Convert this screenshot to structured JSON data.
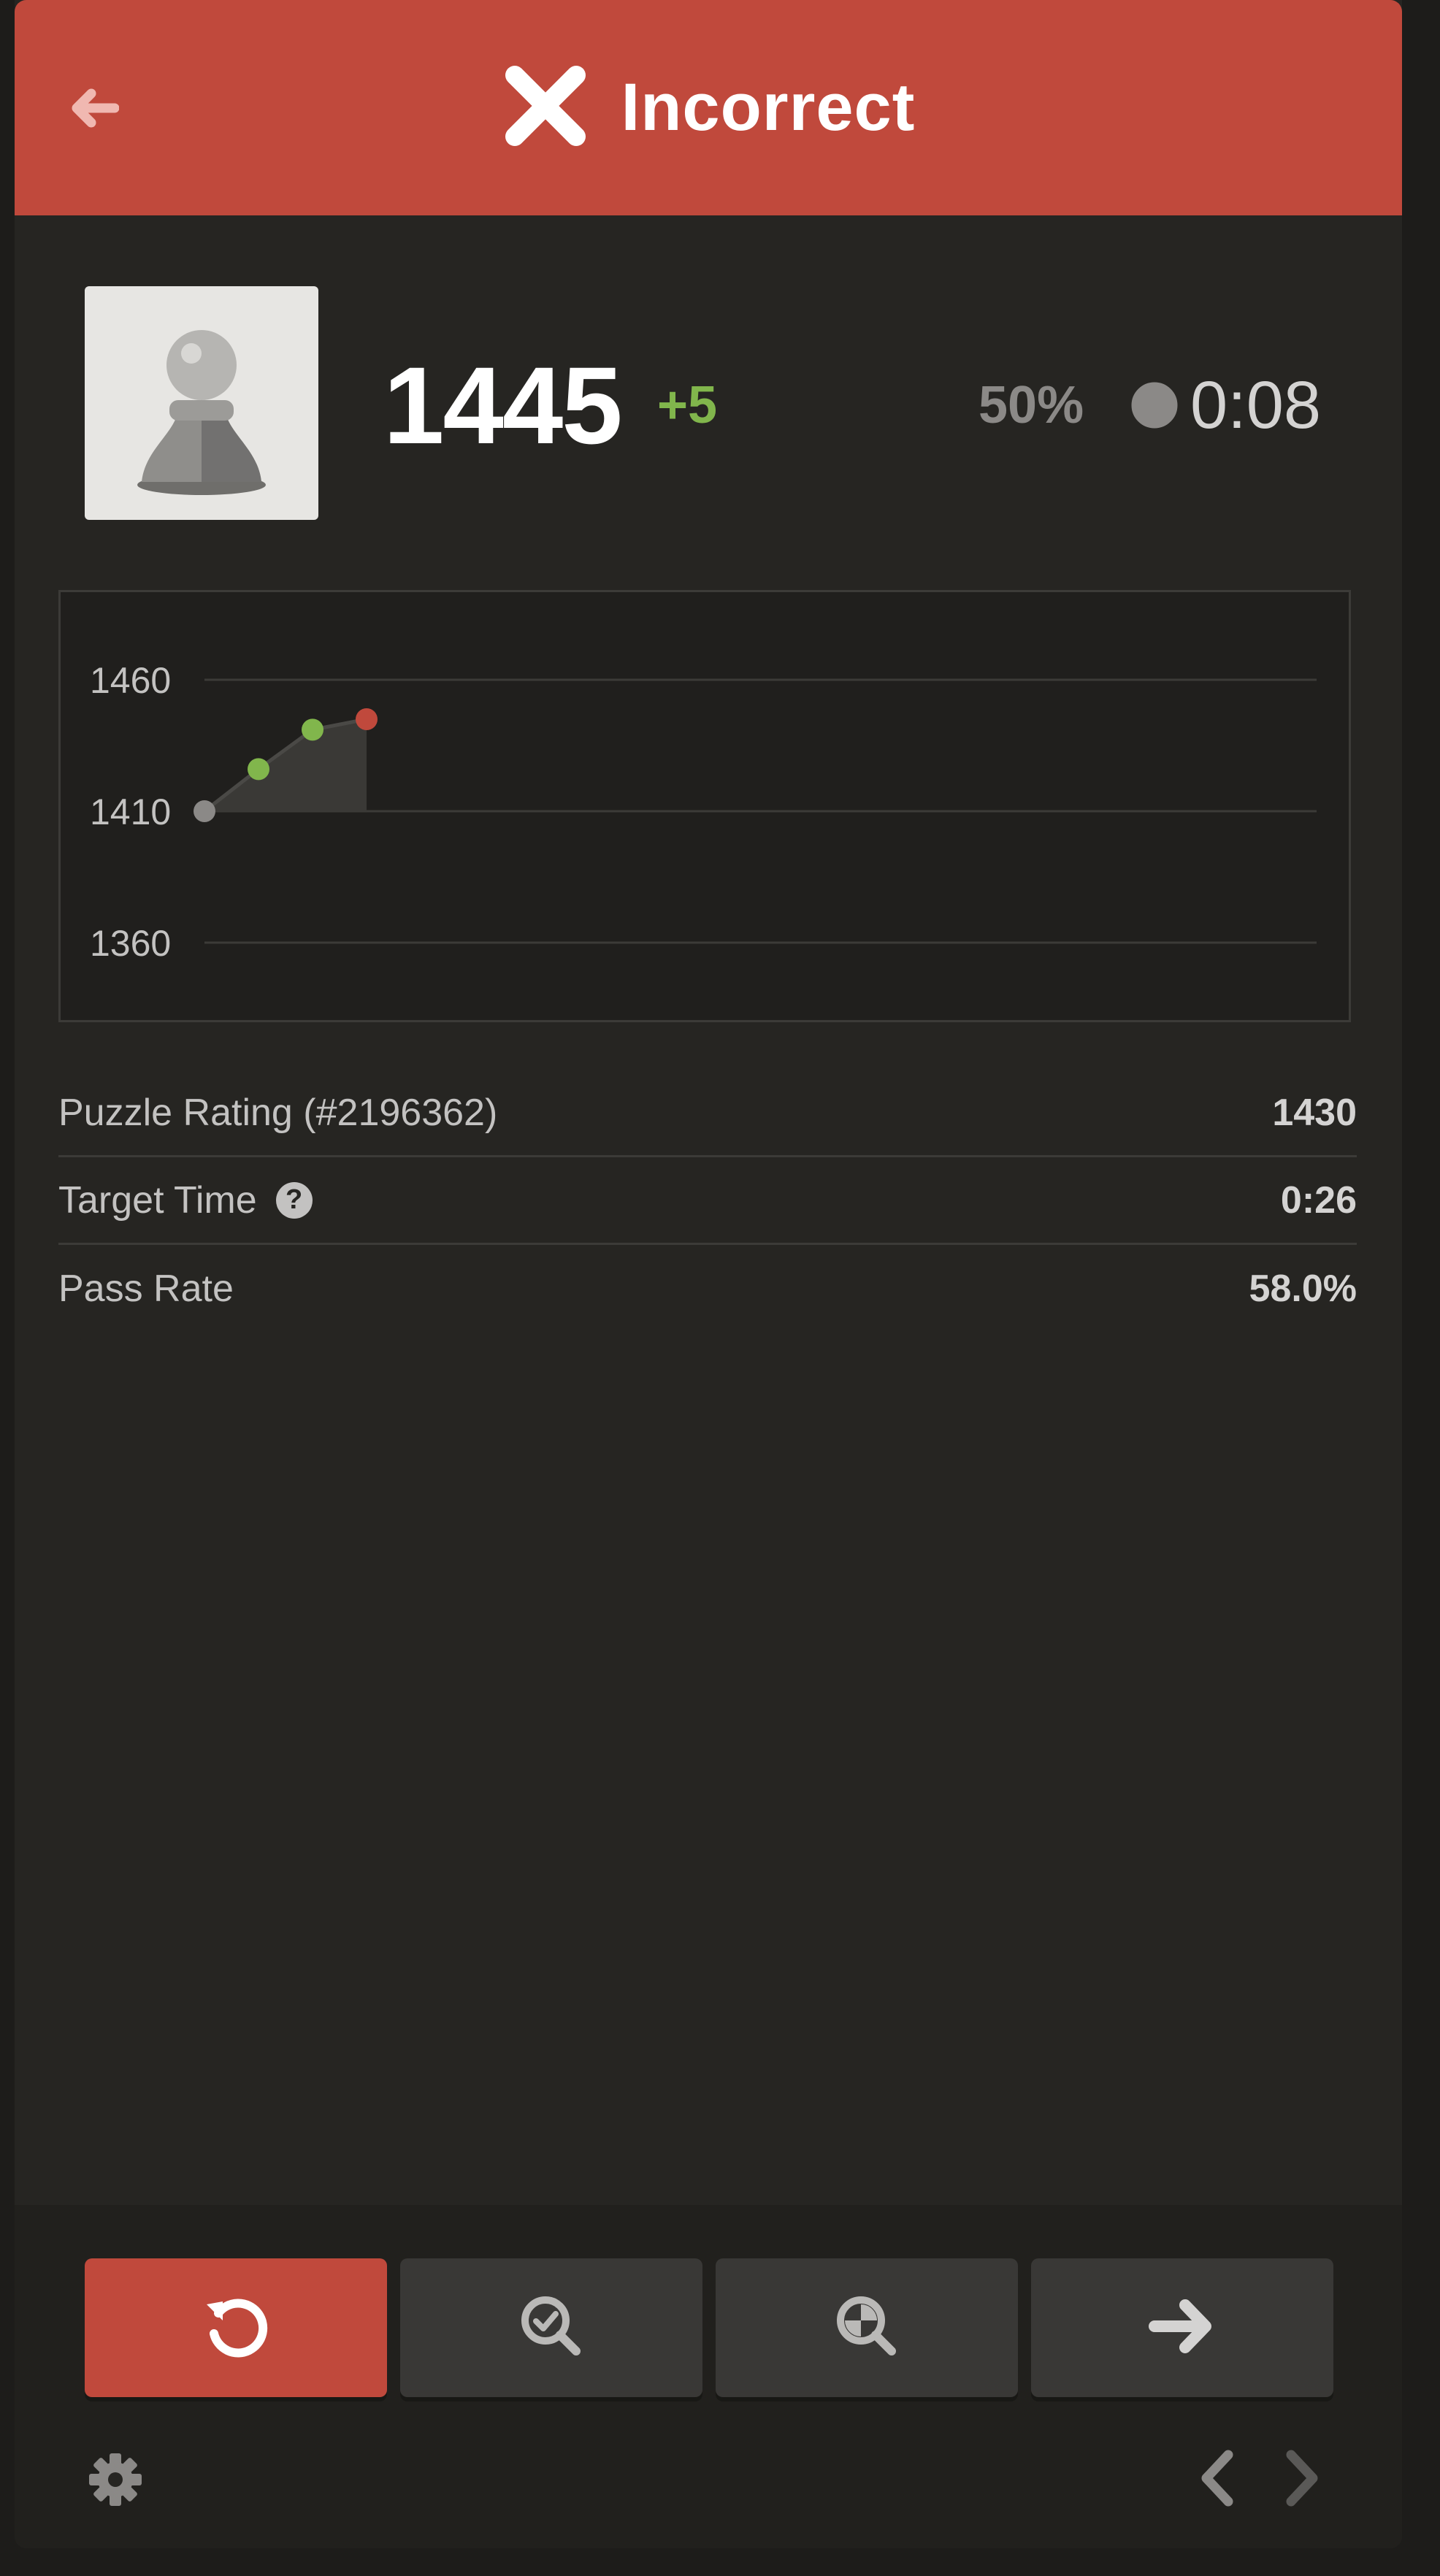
{
  "header": {
    "title": "Incorrect",
    "back_icon": "arrow-left-icon",
    "status_icon": "x-mark-icon",
    "color": "#c0493c"
  },
  "player": {
    "avatar_icon": "pawn-icon",
    "rating": "1445",
    "rating_delta": "+5",
    "accuracy": "50%",
    "time_icon": "pie-timer-icon",
    "time": "0:08"
  },
  "chart_data": {
    "type": "line",
    "y_ticks": [
      "1460",
      "1410",
      "1360"
    ],
    "ylim": [
      1360,
      1460
    ],
    "x": [
      1,
      2,
      3,
      4
    ],
    "values": [
      1410,
      1426,
      1441,
      1445
    ],
    "point_colors": [
      "#8b8987",
      "#81b64c",
      "#81b64c",
      "#c0493c"
    ],
    "grid": true,
    "fill": true
  },
  "stats": {
    "puzzle_rating_label": "Puzzle Rating (#2196362)",
    "puzzle_rating_value": "1430",
    "target_time_label": "Target Time",
    "target_time_value": "0:26",
    "pass_rate_label": "Pass Rate",
    "pass_rate_value": "58.0%"
  },
  "actions": {
    "retry_icon": "retry-icon",
    "solution_icon": "magnifier-check-icon",
    "analysis_icon": "magnifier-chess-icon",
    "next_icon": "arrow-right-icon"
  },
  "footer": {
    "settings_icon": "gear-icon",
    "prev_icon": "chevron-left-icon",
    "next_icon": "chevron-right-icon"
  }
}
